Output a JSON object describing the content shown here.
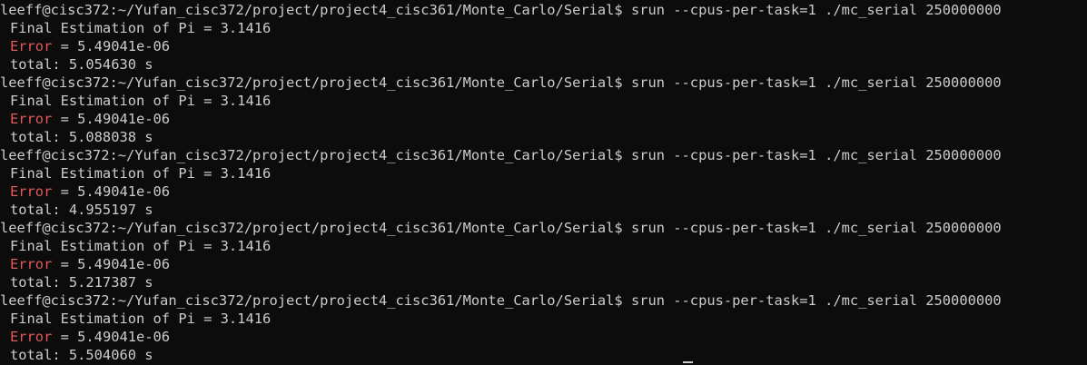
{
  "terminal": {
    "runs": [
      {
        "prompt": "leeff@cisc372:~/Yufan_cisc372/project/project4_cisc361/Monte_Carlo/Serial$ srun --cpus-per-task=1 ./mc_serial 250000000",
        "estimation": "Final Estimation of Pi = 3.1416",
        "error_label": "Error",
        "error_value": " = 5.49041e-06",
        "total": "total: 5.054630 s"
      },
      {
        "prompt": "leeff@cisc372:~/Yufan_cisc372/project/project4_cisc361/Monte_Carlo/Serial$ srun --cpus-per-task=1 ./mc_serial 250000000",
        "estimation": "Final Estimation of Pi = 3.1416",
        "error_label": "Error",
        "error_value": " = 5.49041e-06",
        "total": "total: 5.088038 s"
      },
      {
        "prompt": "leeff@cisc372:~/Yufan_cisc372/project/project4_cisc361/Monte_Carlo/Serial$ srun --cpus-per-task=1 ./mc_serial 250000000",
        "estimation": "Final Estimation of Pi = 3.1416",
        "error_label": "Error",
        "error_value": " = 5.49041e-06",
        "total": "total: 4.955197 s"
      },
      {
        "prompt": "leeff@cisc372:~/Yufan_cisc372/project/project4_cisc361/Monte_Carlo/Serial$ srun --cpus-per-task=1 ./mc_serial 250000000",
        "estimation": "Final Estimation of Pi = 3.1416",
        "error_label": "Error",
        "error_value": " = 5.49041e-06",
        "total": "total: 5.217387 s"
      },
      {
        "prompt": "leeff@cisc372:~/Yufan_cisc372/project/project4_cisc361/Monte_Carlo/Serial$ srun --cpus-per-task=1 ./mc_serial 250000000",
        "estimation": "Final Estimation of Pi = 3.1416",
        "error_label": "Error",
        "error_value": " = 5.49041e-06",
        "total": "total: 5.504060 s"
      }
    ],
    "colors": {
      "background": "#0c0c0c",
      "text": "#cccccc",
      "error": "#e05a5a"
    }
  }
}
